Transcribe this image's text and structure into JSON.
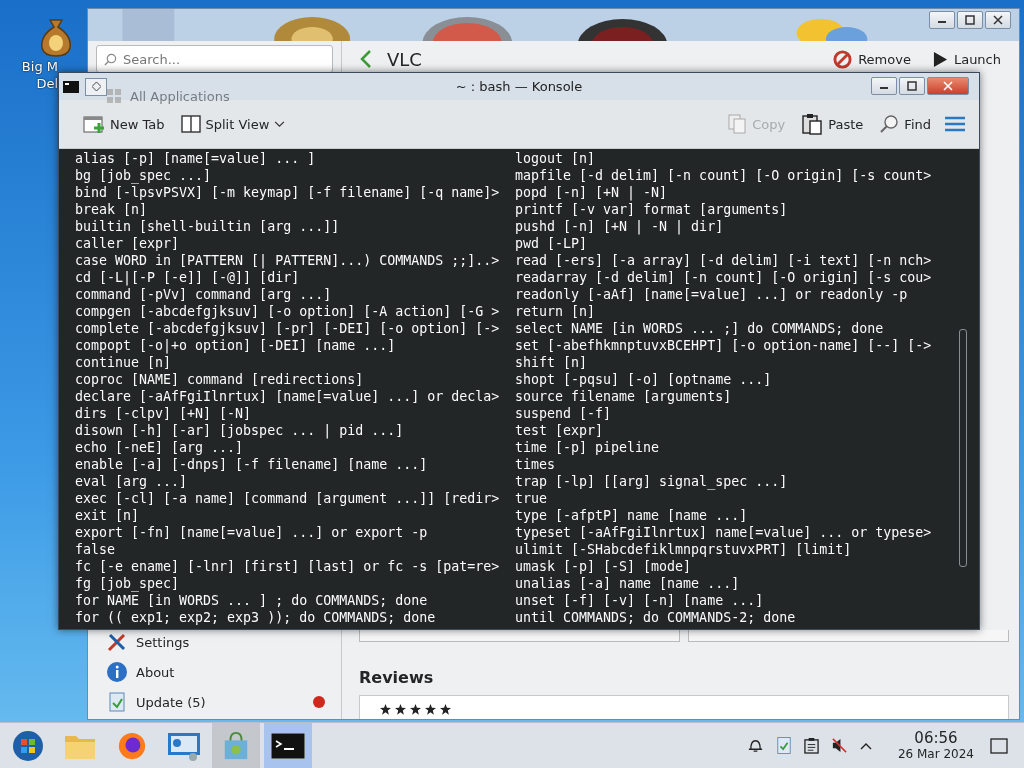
{
  "desktop": {
    "icon": {
      "label_lines": [
        "Big M",
        "Del"
      ]
    }
  },
  "discover": {
    "search": {
      "placeholder": "Search..."
    },
    "sidebar_top": [
      {
        "label": "All Applications",
        "kind": "grid"
      }
    ],
    "sidebar_bottom": [
      {
        "label": "Settings",
        "kind": "settings",
        "badge": false
      },
      {
        "label": "About",
        "kind": "about",
        "badge": false
      },
      {
        "label": "Update (5)",
        "kind": "update",
        "badge": true
      }
    ],
    "page_title": "VLC",
    "actions": [
      {
        "label": "Remove",
        "kind": "remove"
      },
      {
        "label": "Launch",
        "kind": "launch"
      }
    ],
    "reviews": {
      "title": "Reviews",
      "stars": 5
    }
  },
  "konsole": {
    "title": "~ : bash — Konsole",
    "toolbar": [
      {
        "label": "New Tab",
        "kind": "newtab",
        "disabled": false
      },
      {
        "label": "Split View",
        "kind": "split",
        "disabled": false
      },
      {
        "label": "Copy",
        "kind": "copy",
        "disabled": true
      },
      {
        "label": "Paste",
        "kind": "paste",
        "disabled": false
      },
      {
        "label": "Find",
        "kind": "find",
        "disabled": false
      }
    ],
    "columns": [
      [
        "alias [-p] [name[=value] ... ]",
        "bg [job_spec ...]",
        "bind [-lpsvPSVX] [-m keymap] [-f filename] [-q name]>",
        "break [n]",
        "builtin [shell-builtin [arg ...]]",
        "caller [expr]",
        "case WORD in [PATTERN [| PATTERN]...) COMMANDS ;;]..>",
        "cd [-L|[-P [-e]] [-@]] [dir]",
        "command [-pVv] command [arg ...]",
        "compgen [-abcdefgjksuv] [-o option] [-A action] [-G >",
        "complete [-abcdefgjksuv] [-pr] [-DEI] [-o option] [->",
        "compopt [-o|+o option] [-DEI] [name ...]",
        "continue [n]",
        "coproc [NAME] command [redirections]",
        "declare [-aAfFgiIlnrtux] [name[=value] ...] or decla>",
        "dirs [-clpv] [+N] [-N]",
        "disown [-h] [-ar] [jobspec ... | pid ...]",
        "echo [-neE] [arg ...]",
        "enable [-a] [-dnps] [-f filename] [name ...]",
        "eval [arg ...]",
        "exec [-cl] [-a name] [command [argument ...]] [redir>",
        "exit [n]",
        "export [-fn] [name[=value] ...] or export -p",
        "false",
        "fc [-e ename] [-lnr] [first] [last] or fc -s [pat=re>",
        "fg [job_spec]",
        "for NAME [in WORDS ... ] ; do COMMANDS; done",
        "for (( exp1; exp2; exp3 )); do COMMANDS; done"
      ],
      [
        "logout [n]",
        "mapfile [-d delim] [-n count] [-O origin] [-s count>",
        "popd [-n] [+N | -N]",
        "printf [-v var] format [arguments]",
        "pushd [-n] [+N | -N | dir]",
        "pwd [-LP]",
        "read [-ers] [-a array] [-d delim] [-i text] [-n nch>",
        "readarray [-d delim] [-n count] [-O origin] [-s cou>",
        "readonly [-aAf] [name[=value] ...] or readonly -p",
        "return [n]",
        "select NAME [in WORDS ... ;] do COMMANDS; done",
        "set [-abefhkmnptuvxBCEHPT] [-o option-name] [--] [->",
        "shift [n]",
        "shopt [-pqsu] [-o] [optname ...]",
        "source filename [arguments]",
        "suspend [-f]",
        "test [expr]",
        "time [-p] pipeline",
        "times",
        "trap [-lp] [[arg] signal_spec ...]",
        "true",
        "type [-afptP] name [name ...]",
        "typeset [-aAfFgiIlnrtux] name[=value] ... or typese>",
        "ulimit [-SHabcdefiklmnpqrstuvxPRT] [limit]",
        "umask [-p] [-S] [mode]",
        "unalias [-a] name [name ...]",
        "unset [-f] [-v] [-n] [name ...]",
        "until COMMANDS; do COMMANDS-2; done"
      ]
    ]
  },
  "taskbar": {
    "tasks": [
      {
        "kind": "start",
        "selected": false
      },
      {
        "kind": "files",
        "selected": false
      },
      {
        "kind": "browser",
        "selected": false
      },
      {
        "kind": "monitor",
        "selected": false
      },
      {
        "kind": "discover",
        "selected": false
      },
      {
        "kind": "terminal",
        "selected": true
      }
    ],
    "tray": [
      {
        "kind": "bell"
      },
      {
        "kind": "clipboard"
      },
      {
        "kind": "notes"
      },
      {
        "kind": "muted"
      }
    ],
    "clock": {
      "time": "06:56",
      "date": "26 Mar 2024"
    }
  }
}
